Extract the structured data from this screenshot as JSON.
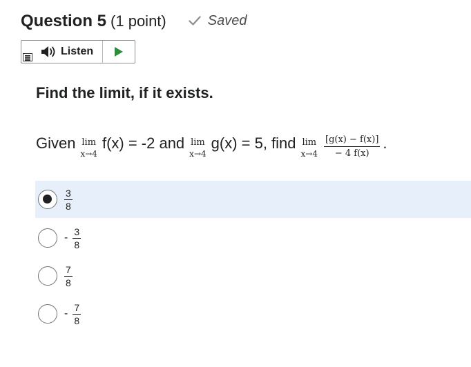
{
  "question": {
    "title": "Question 5",
    "points": "(1 point)",
    "status": "Saved"
  },
  "listen": {
    "label": "Listen"
  },
  "prompt": "Find the limit, if it exists.",
  "given": {
    "t1": "Given",
    "lim1_top": "lim",
    "lim1_bottom": "x→4",
    "t2": "f(x) = -2 and",
    "lim2_top": "lim",
    "lim2_bottom": "x→4",
    "t3": "g(x) = 5, find",
    "lim3_top": "lim",
    "lim3_bottom": "x→4",
    "frac_num": "[g(x) − f(x)]",
    "frac_den": "− 4 f(x)",
    "period": "."
  },
  "options": [
    {
      "sign": "",
      "num": "3",
      "den": "8",
      "selected": true
    },
    {
      "sign": "-",
      "num": "3",
      "den": "8",
      "selected": false
    },
    {
      "sign": "",
      "num": "7",
      "den": "8",
      "selected": false
    },
    {
      "sign": "-",
      "num": "7",
      "den": "8",
      "selected": false
    }
  ],
  "colors": {
    "selected_bg": "#e7effb",
    "play_green": "#2e8b3c",
    "check_gray": "#8a8d8f"
  },
  "icons": [
    "check-icon",
    "speaker-icon",
    "play-icon",
    "menu-icon"
  ]
}
